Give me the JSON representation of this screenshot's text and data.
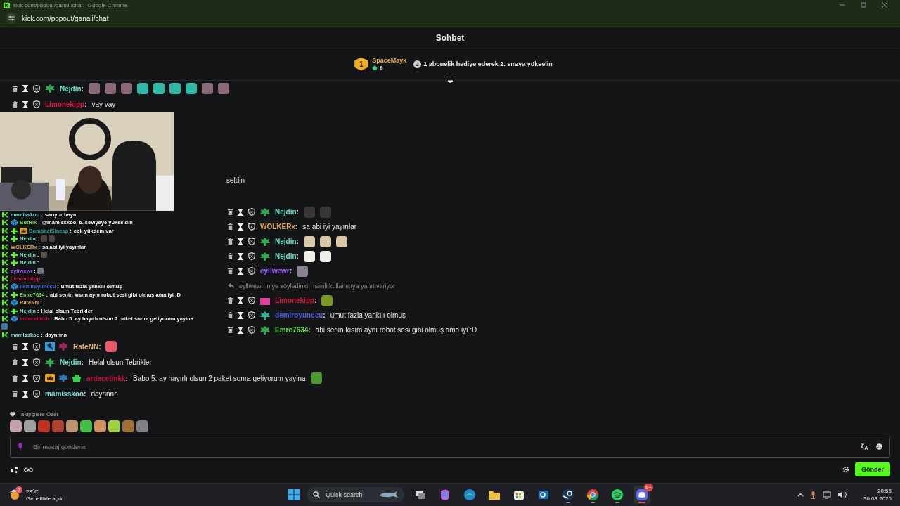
{
  "browser": {
    "title": "kick.com/popout/ganali/chat - Google Chrome",
    "url": "kick.com/popout/ganali/chat"
  },
  "chat": {
    "title": "Sohbet",
    "separator": ":",
    "pinned": {
      "rank": "1",
      "user": "SpaceMayk",
      "count": "6",
      "next_rank": "2",
      "message": "1 abonelik hediye ederek 2. sıraya yükselin"
    },
    "top_messages": [
      {
        "kind": "message",
        "user": "Nejdin",
        "color": "#5ee0c4",
        "badges": [
          {
            "kind": "sprout",
            "color": "#2fa84f"
          }
        ],
        "emotes": [
          {
            "color": "#8a6a78"
          },
          {
            "color": "#8a6a78"
          },
          {
            "color": "#8a6a78"
          },
          {
            "color": "#2fb8a8"
          },
          {
            "color": "#2fb8a8"
          },
          {
            "color": "#2fb8a8"
          },
          {
            "color": "#2fb8a8"
          },
          {
            "color": "#8a6a78"
          },
          {
            "color": "#8a6a78"
          }
        ]
      },
      {
        "kind": "message",
        "user": "Limonekipp",
        "color": "#e0173f",
        "text": "vay vay"
      }
    ],
    "overlay": {
      "kind": "picture",
      "separator": " : ",
      "lines": [
        {
          "user": "mamisskoo",
          "color": "#7fe0e0",
          "badges": [
            {
              "kind": "kick",
              "color": "#53fc18"
            }
          ],
          "text": "sarıyor baya"
        },
        {
          "user": "BotRix",
          "color": "#6ee04a",
          "badges": [
            {
              "kind": "kick",
              "color": "#53fc18"
            },
            {
              "kind": "cube",
              "color": "#2a90d0"
            }
          ],
          "text": "@mamisskoo, 6. seviyeye yükseldin"
        },
        {
          "user": "BombaciSincap",
          "color": "#2aa89a",
          "badges": [
            {
              "kind": "kick",
              "color": "#53fc18"
            },
            {
              "kind": "plus",
              "color": "#53fc18"
            },
            {
              "kind": "crown",
              "color": "#e0a020"
            }
          ],
          "text": "cok yükdem var"
        },
        {
          "user": "Nejdin",
          "color": "#7fe0c4",
          "badges": [
            {
              "kind": "kick",
              "color": "#53fc18"
            },
            {
              "kind": "plus",
              "color": "#53fc18"
            }
          ],
          "emotes": [
            {
              "color": "#4a4244"
            },
            {
              "color": "#4a4244"
            }
          ]
        },
        {
          "user": "WOLKERx",
          "color": "#e0a850",
          "badges": [
            {
              "kind": "kick",
              "color": "#53fc18"
            }
          ],
          "text": "sa abi iyi yayınlar"
        },
        {
          "user": "Nejdin",
          "color": "#7fe0c4",
          "badges": [
            {
              "kind": "kick",
              "color": "#53fc18"
            },
            {
              "kind": "plus",
              "color": "#53fc18"
            }
          ],
          "emotes": [
            {
              "color": "#5a5248"
            }
          ]
        },
        {
          "user": "Nejdin",
          "color": "#7fe0c4",
          "badges": [
            {
              "kind": "kick",
              "color": "#53fc18"
            },
            {
              "kind": "plus",
              "color": "#53fc18"
            }
          ]
        },
        {
          "user": "eyllwewr",
          "color": "#9b59ff",
          "badges": [
            {
              "kind": "kick",
              "color": "#53fc18"
            }
          ],
          "emotes": [
            {
              "color": "#7a7088"
            }
          ]
        },
        {
          "user": "Limonekipp",
          "color": "#e0173f",
          "badges": [
            {
              "kind": "kick",
              "color": "#53fc18"
            }
          ]
        },
        {
          "user": "demiroyunccu",
          "color": "#4a6cf0",
          "badges": [
            {
              "kind": "kick",
              "color": "#53fc18"
            },
            {
              "kind": "cube",
              "color": "#2a90d0"
            }
          ],
          "text": "umut fazla yankılı olmuş"
        },
        {
          "user": "Emre7634",
          "color": "#6ee04a",
          "badges": [
            {
              "kind": "kick",
              "color": "#53fc18"
            },
            {
              "kind": "plus",
              "color": "#53fc18"
            }
          ],
          "text": "abi senin kısım aynı robot sesi gibi olmuş ama iyi :D"
        },
        {
          "user": "RateNN",
          "color": "#e0b070",
          "badges": [
            {
              "kind": "kick",
              "color": "#53fc18"
            },
            {
              "kind": "cube",
              "color": "#2a90d0"
            }
          ]
        },
        {
          "user": "Nejdin",
          "color": "#7fe0c4",
          "badges": [
            {
              "kind": "kick",
              "color": "#53fc18"
            },
            {
              "kind": "plus",
              "color": "#53fc18"
            }
          ],
          "text": "Helal olsun Tebrikler"
        },
        {
          "user": "ardacetinkk",
          "color": "#c8143c",
          "badges": [
            {
              "kind": "kick",
              "color": "#53fc18"
            },
            {
              "kind": "cube",
              "color": "#2a90d0"
            }
          ],
          "text": "Babo 5. ay hayırlı olsun 2 paket sonra geliyorum yayina"
        },
        {
          "emotes": [
            {
              "color": "#3a7ab0"
            }
          ]
        },
        {
          "user": "mamisskoo",
          "color": "#7fe0e0",
          "badges": [
            {
              "kind": "kick",
              "color": "#53fc18"
            }
          ],
          "text": "daynnnn"
        }
      ]
    },
    "middle_messages": [
      {
        "kind": "fragment",
        "text": "seldin"
      },
      {
        "kind": "message",
        "user": "Nejdin",
        "color": "#5ee0c4",
        "badges": [
          {
            "kind": "sprout",
            "color": "#2fa84f"
          }
        ],
        "emotes": [
          {
            "color": "#3a3638"
          },
          {
            "color": "#3a3638"
          }
        ]
      },
      {
        "kind": "message",
        "user": "WOLKERx",
        "color": "#e0a850",
        "text": "sa abi iyi yayınlar"
      },
      {
        "kind": "message",
        "user": "Nejdin",
        "color": "#5ee0c4",
        "badges": [
          {
            "kind": "sprout",
            "color": "#2fa84f"
          }
        ],
        "emotes": [
          {
            "color": "#d8c8a8"
          },
          {
            "color": "#d8c8a8"
          },
          {
            "color": "#d8c8a8"
          }
        ]
      },
      {
        "kind": "message",
        "user": "Nejdin",
        "color": "#5ee0c4",
        "badges": [
          {
            "kind": "sprout",
            "color": "#2fa84f"
          }
        ],
        "emotes": [
          {
            "color": "#f0f0e8"
          },
          {
            "color": "#f0f0e8"
          }
        ]
      },
      {
        "kind": "message",
        "user": "eyllwewr",
        "color": "#9b59ff",
        "emotes": [
          {
            "color": "#8a8090"
          }
        ]
      },
      {
        "kind": "reply",
        "text": "eyllwewr: niye söyledinki",
        "note": "İsimli kullanıcıya yanıt veriyor"
      },
      {
        "kind": "message",
        "user": "Limonekipp",
        "color": "#e0173f",
        "badges": [
          {
            "kind": "gem",
            "color": "#e040a0"
          }
        ],
        "emotes": [
          {
            "color": "#7a9a20"
          }
        ]
      },
      {
        "kind": "message",
        "user": "demiroyunccu",
        "color": "#4a5cf0",
        "badges": [
          {
            "kind": "sprout",
            "color": "#2ab0a0"
          }
        ],
        "text": "umut fazla yankılı olmuş"
      },
      {
        "kind": "message",
        "user": "Emre7634",
        "color": "#6ee04a",
        "badges": [
          {
            "kind": "sprout",
            "color": "#2fa84f"
          }
        ],
        "text": "abi senin kısım aynı robot sesi gibi olmuş ama iyi :D"
      }
    ],
    "bottom_messages": [
      {
        "kind": "message",
        "user": "RateNN",
        "color": "#e0b070",
        "badges": [
          {
            "kind": "hammer",
            "color": "#2aa0e0"
          },
          {
            "kind": "sprout",
            "color": "#a02060"
          }
        ],
        "emotes": [
          {
            "color": "#e85a6a"
          }
        ]
      },
      {
        "kind": "message",
        "user": "Nejdin",
        "color": "#5ee0c4",
        "badges": [
          {
            "kind": "sprout",
            "color": "#2fa84f"
          }
        ],
        "text": "Helal olsun Tebrikler"
      },
      {
        "kind": "message",
        "user": "ardacetinkk",
        "color": "#c8143c",
        "badges": [
          {
            "kind": "crown",
            "color": "#e0a020"
          },
          {
            "kind": "sprout",
            "color": "#2a7ab0"
          },
          {
            "kind": "gift",
            "color": "#3ad04a"
          }
        ],
        "text": "Babo 5. ay hayırlı olsun 2 paket sonra geliyorum yayina",
        "emotes": [
          {
            "color": "#4a9a30"
          }
        ]
      },
      {
        "kind": "message",
        "user": "mamisskoo",
        "color": "#7fe0e0",
        "text": "daynnnn"
      }
    ],
    "followers": {
      "label": "Takipçilere Özel",
      "emotes": [
        {
          "color": "#c8a0b0"
        },
        {
          "color": "#a0a0a0"
        },
        {
          "color": "#c03020"
        },
        {
          "color": "#b04030"
        },
        {
          "color": "#c09070"
        },
        {
          "color": "#40c040"
        },
        {
          "color": "#d09060"
        },
        {
          "color": "#a0d040"
        },
        {
          "color": "#a07030"
        },
        {
          "color": "#808088"
        }
      ]
    },
    "input": {
      "placeholder": "Bir mesaj gönderin"
    },
    "send": "Gönder"
  },
  "taskbar": {
    "weather": {
      "badge": "7",
      "temp": "28°C",
      "condition": "Genellikle açık"
    },
    "search": {
      "placeholder": "Quick search"
    },
    "apps": [
      {
        "kind": "taskview",
        "running": false,
        "selected": false
      },
      {
        "kind": "copilot",
        "running": false,
        "selected": false
      },
      {
        "kind": "edge",
        "running": false,
        "selected": false
      },
      {
        "kind": "explorer",
        "running": false,
        "selected": false
      },
      {
        "kind": "store",
        "running": false,
        "selected": false
      },
      {
        "kind": "outlook",
        "running": false,
        "selected": false
      },
      {
        "kind": "steam",
        "running": true,
        "selected": false
      },
      {
        "kind": "chrome",
        "running": true,
        "selected": false
      },
      {
        "kind": "spotify",
        "running": true,
        "selected": false
      },
      {
        "kind": "discord",
        "running": true,
        "selected": true,
        "badge": "9+"
      }
    ],
    "time": "20:55",
    "date": "30.08.2025"
  }
}
